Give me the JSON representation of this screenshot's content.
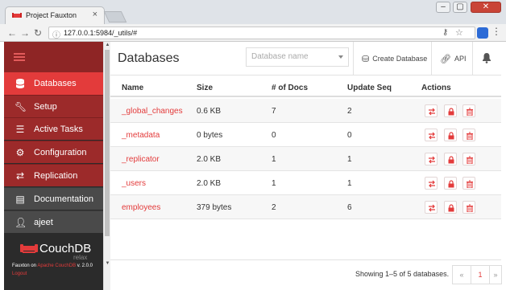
{
  "browser": {
    "tab_title": "Project Fauxton",
    "url": "127.0.0.1:5984/_utils/#"
  },
  "sidebar": {
    "items": [
      {
        "label": "Databases",
        "icon": "database-icon"
      },
      {
        "label": "Setup",
        "icon": "wrench-icon"
      },
      {
        "label": "Active Tasks",
        "icon": "tasks-icon"
      },
      {
        "label": "Configuration",
        "icon": "gear-icon"
      },
      {
        "label": "Replication",
        "icon": "replication-icon"
      },
      {
        "label": "Documentation",
        "icon": "book-icon"
      },
      {
        "label": "ajeet",
        "icon": "user-icon"
      }
    ],
    "logo_name": "CouchDB",
    "logo_tagline": "relax",
    "version_prefix": "Fauxton on",
    "version_link": "Apache CouchDB",
    "version_suffix": "v. 2.0.0",
    "logout": "Logout"
  },
  "header": {
    "title": "Databases",
    "search_placeholder": "Database name",
    "create_label": "Create Database",
    "api_label": "API"
  },
  "table": {
    "columns": [
      "Name",
      "Size",
      "# of Docs",
      "Update Seq",
      "Actions"
    ],
    "rows": [
      {
        "name": "_global_changes",
        "size": "0.6 KB",
        "docs": "7",
        "seq": "2"
      },
      {
        "name": "_metadata",
        "size": "0 bytes",
        "docs": "0",
        "seq": "0"
      },
      {
        "name": "_replicator",
        "size": "2.0 KB",
        "docs": "1",
        "seq": "1"
      },
      {
        "name": "_users",
        "size": "2.0 KB",
        "docs": "1",
        "seq": "1"
      },
      {
        "name": "employees",
        "size": "379 bytes",
        "docs": "2",
        "seq": "6"
      }
    ]
  },
  "footer": {
    "showing": "Showing 1–5 of 5 databases.",
    "prev": "«",
    "page": "1",
    "next": "»"
  },
  "colors": {
    "accent": "#e33b3b",
    "sidebar_dark": "#2b2b2b",
    "sidebar_red": "#9c2a2a"
  }
}
